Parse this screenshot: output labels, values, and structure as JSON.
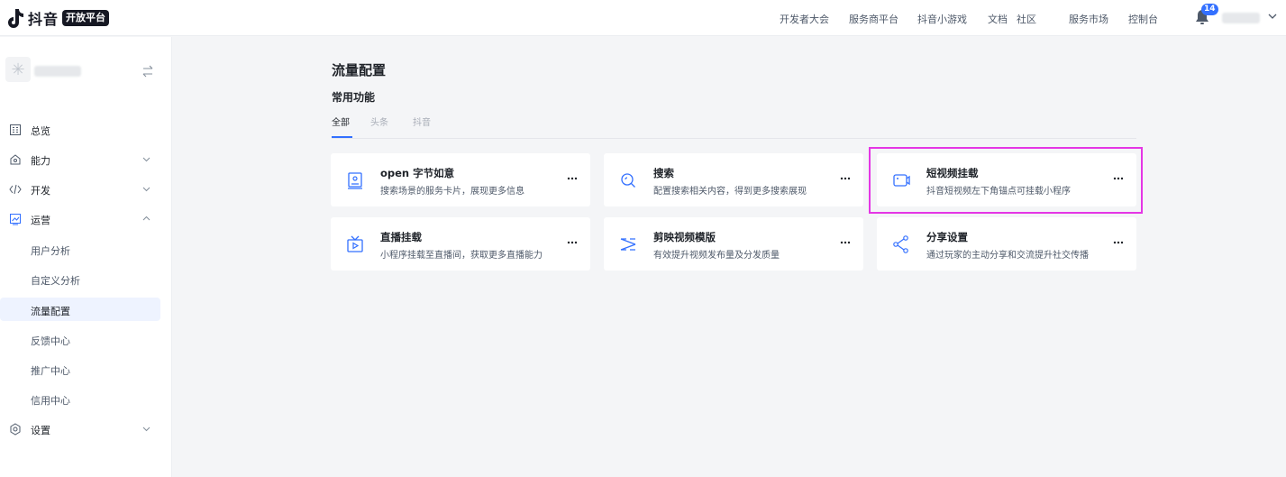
{
  "header": {
    "brand": "抖音",
    "brand_badge": "开放平台",
    "nav": [
      "开发者大会",
      "服务商平台",
      "抖音小游戏",
      "文档",
      "社区",
      "服务市场",
      "控制台"
    ],
    "notification_count": "14"
  },
  "sidebar": {
    "items": [
      {
        "label": "总览",
        "icon": "overview-icon"
      },
      {
        "label": "能力",
        "icon": "ability-icon"
      },
      {
        "label": "开发",
        "icon": "code-icon"
      },
      {
        "label": "运营",
        "icon": "operation-icon"
      }
    ],
    "sub_items": [
      "用户分析",
      "自定义分析",
      "流量配置",
      "反馈中心",
      "推广中心",
      "信用中心"
    ],
    "active_sub_item": "流量配置",
    "settings_label": "设置"
  },
  "main": {
    "title": "流量配置",
    "section_title": "常用功能",
    "tabs": [
      "全部",
      "头条",
      "抖音"
    ],
    "active_tab": "全部",
    "cards": [
      {
        "title": "open 字节如意",
        "desc": "搜索场景的服务卡片，展现更多信息",
        "icon": "card-id-icon"
      },
      {
        "title": "搜索",
        "desc": "配置搜索相关内容，得到更多搜索展现",
        "icon": "search-icon"
      },
      {
        "title": "短视频挂载",
        "desc": "抖音短视频左下角锚点可挂载小程序",
        "icon": "video-mount-icon"
      },
      {
        "title": "直播挂载",
        "desc": "小程序挂载至直播间，获取更多直播能力",
        "icon": "live-icon"
      },
      {
        "title": "剪映视频模版",
        "desc": "有效提升视频发布量及分发质量",
        "icon": "capcut-icon"
      },
      {
        "title": "分享设置",
        "desc": "通过玩家的主动分享和交流提升社交传播",
        "icon": "share-icon"
      }
    ]
  },
  "colors": {
    "accent": "#3370ff",
    "highlight": "#e536e5"
  }
}
